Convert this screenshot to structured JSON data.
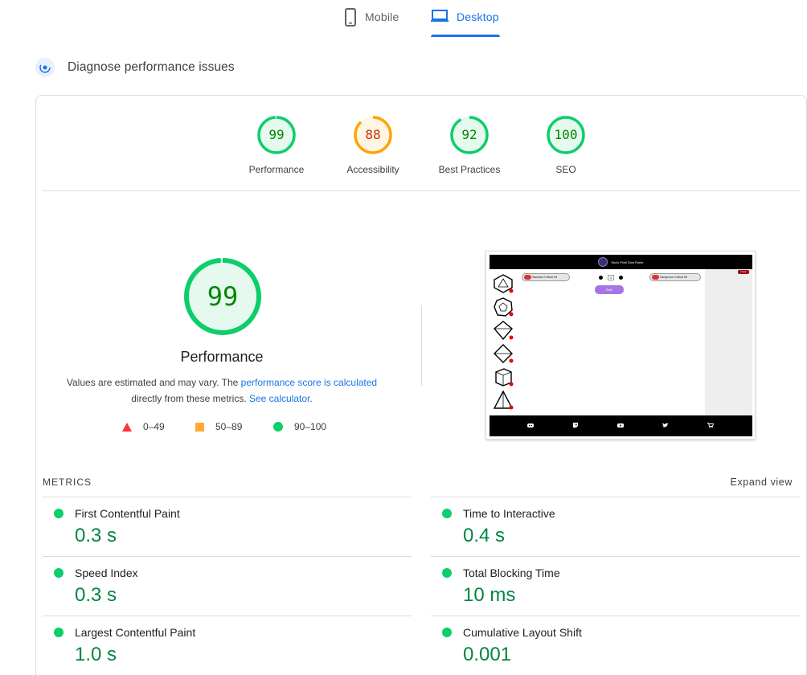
{
  "tabs": [
    {
      "label": "Mobile",
      "icon": "phone-icon",
      "active": false
    },
    {
      "label": "Desktop",
      "icon": "laptop-icon",
      "active": true
    }
  ],
  "diagnose": {
    "title": "Diagnose performance issues",
    "icon": "lighthouse-icon"
  },
  "categories": [
    {
      "label": "Performance",
      "score": "99",
      "status": "pass",
      "color": "#0cce6b"
    },
    {
      "label": "Accessibility",
      "score": "88",
      "status": "average",
      "color": "#ffa400"
    },
    {
      "label": "Best Practices",
      "score": "92",
      "status": "pass",
      "color": "#0cce6b"
    },
    {
      "label": "SEO",
      "score": "100",
      "status": "pass",
      "color": "#0cce6b"
    }
  ],
  "main": {
    "score": "99",
    "title": "Performance",
    "note_prefix": "Values are estimated and may vary. The ",
    "note_link1": "performance score is calculated",
    "note_middle": " directly from these metrics. ",
    "note_link2": "See calculator",
    "note_suffix": "."
  },
  "legend": [
    {
      "range": "0–49",
      "shape": "triangle",
      "color": "#ff3333"
    },
    {
      "range": "50–89",
      "shape": "square",
      "color": "#ffaa33"
    },
    {
      "range": "90–100",
      "shape": "circle",
      "color": "#0cce6b"
    }
  ],
  "screenshot": {
    "site_title": "Stuck Pixel Dice Roller",
    "toggle_left": "Standard Critical Hit",
    "toggle_right": "Dangerous Critical Hit",
    "counter_value": "0",
    "roll_label": "Roll!",
    "clear_label": "Clear"
  },
  "metrics": {
    "header": "METRICS",
    "expand_label": "Expand view",
    "items": [
      {
        "name": "First Contentful Paint",
        "value": "0.3 s"
      },
      {
        "name": "Time to Interactive",
        "value": "0.4 s"
      },
      {
        "name": "Speed Index",
        "value": "0.3 s"
      },
      {
        "name": "Total Blocking Time",
        "value": "10 ms"
      },
      {
        "name": "Largest Contentful Paint",
        "value": "1.0 s"
      },
      {
        "name": "Cumulative Layout Shift",
        "value": "0.001"
      }
    ]
  }
}
